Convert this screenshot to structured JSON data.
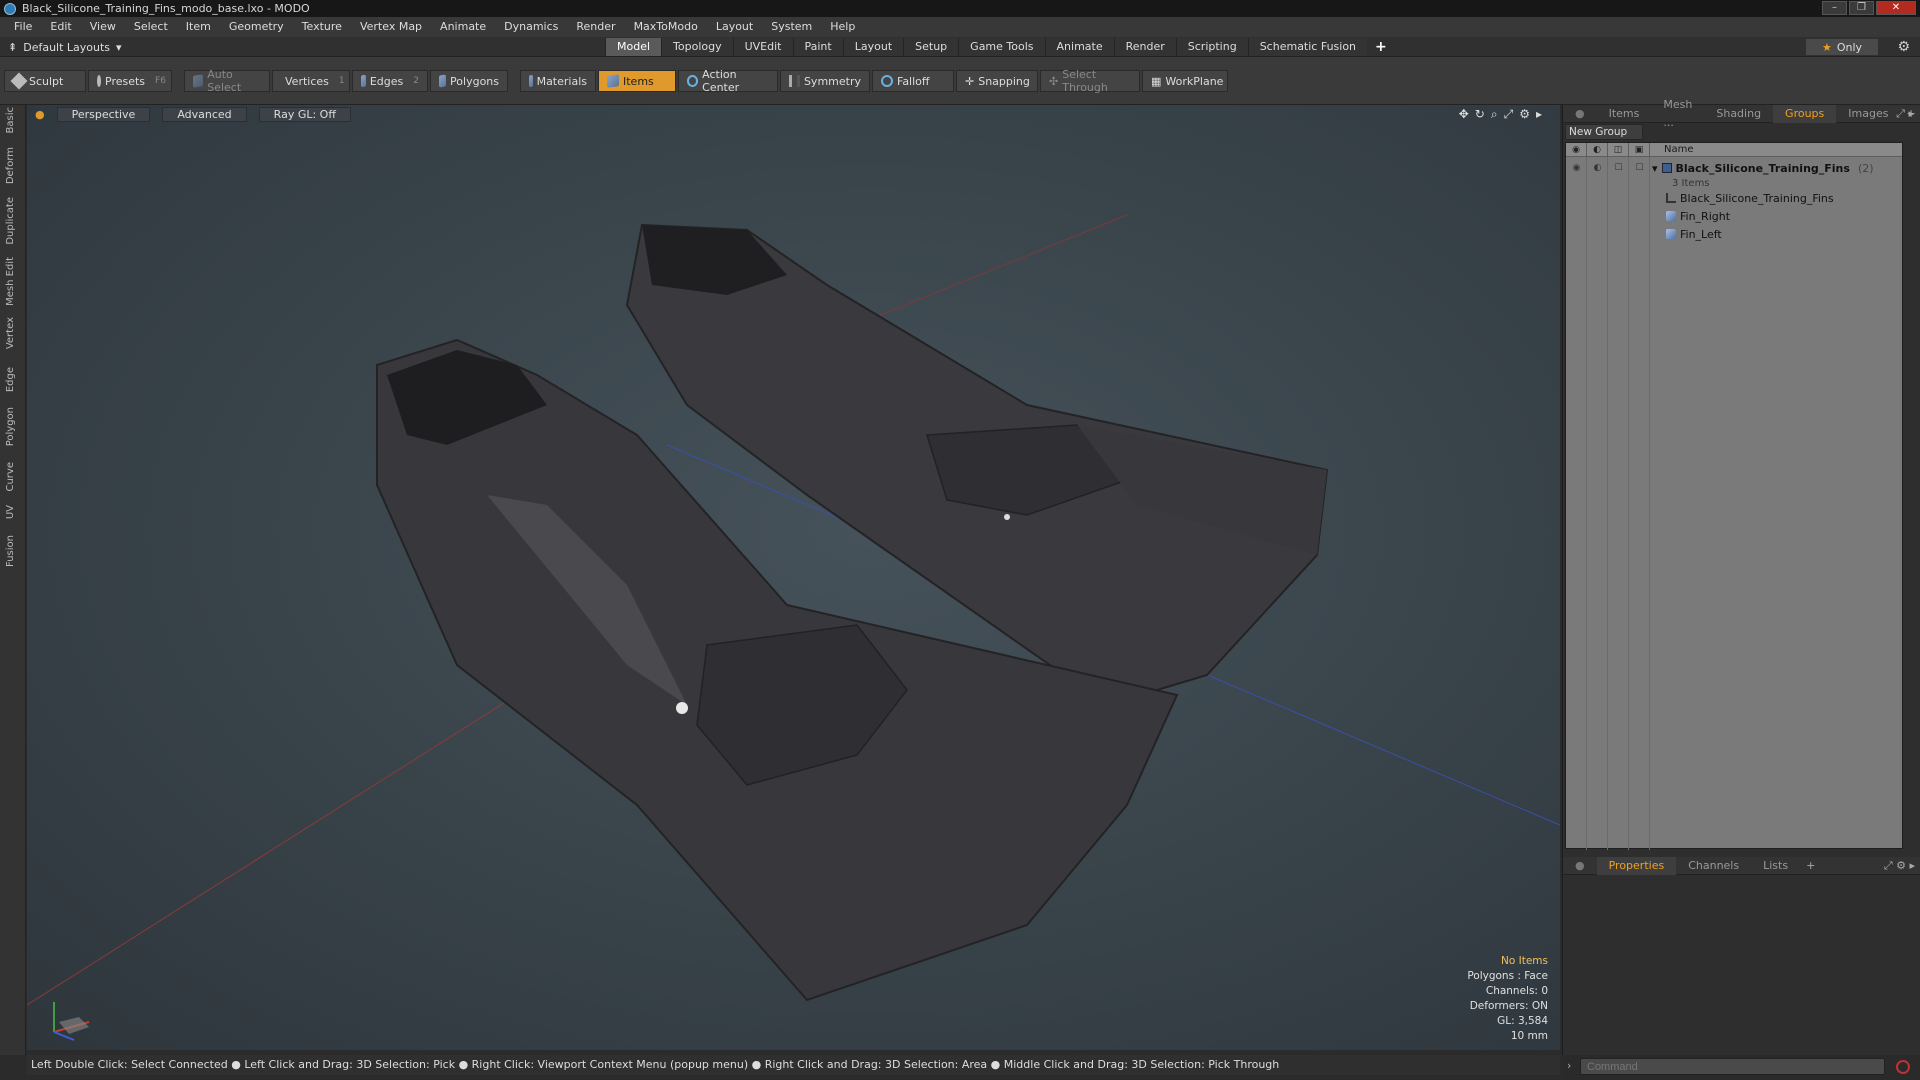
{
  "window": {
    "title": "Black_Silicone_Training_Fins_modo_base.lxo - MODO",
    "controls": [
      "–",
      "❐",
      "✕"
    ]
  },
  "menubar": [
    "File",
    "Edit",
    "View",
    "Select",
    "Item",
    "Geometry",
    "Texture",
    "Vertex Map",
    "Animate",
    "Dynamics",
    "Render",
    "MaxToModo",
    "Layout",
    "System",
    "Help"
  ],
  "layoutbar": {
    "layout_selector": "Default Layouts",
    "tabs": [
      "Model",
      "Topology",
      "UVEdit",
      "Paint",
      "Layout",
      "Setup",
      "Game Tools",
      "Animate",
      "Render",
      "Scripting",
      "Schematic Fusion"
    ],
    "active_tab": "Model",
    "add": "+",
    "only_label": "Only"
  },
  "toolbar": {
    "sculpt": "Sculpt",
    "presets": "Presets",
    "presets_key": "F6",
    "auto_select": "Auto Select",
    "vertices": "Vertices",
    "vertices_count": "1",
    "edges": "Edges",
    "edges_count": "2",
    "polygons": "Polygons",
    "materials": "Materials",
    "items": "Items",
    "action_center": "Action Center",
    "symmetry": "Symmetry",
    "falloff": "Falloff",
    "snapping": "Snapping",
    "select_through": "Select Through",
    "workplane": "WorkPlane"
  },
  "left_tabs": [
    "Basic",
    "Deform",
    "Duplicate",
    "Mesh Edit",
    "Vertex",
    "Edge",
    "Polygon",
    "Curve",
    "UV",
    "Fusion"
  ],
  "viewport": {
    "view_mode": "Perspective",
    "shading": "Advanced",
    "raygl": "Ray GL: Off",
    "stats": {
      "selection": "No Items",
      "polygons": "Polygons : Face",
      "channels": "Channels: 0",
      "deformers": "Deformers: ON",
      "gl": "GL: 3,584",
      "scale": "10 mm"
    }
  },
  "statusbar": "Left Double Click: Select Connected ● Left Click and Drag: 3D Selection: Pick ● Right Click: Viewport Context Menu (popup menu) ● Right Click and Drag: 3D Selection: Area ● Middle Click and Drag: 3D Selection: Pick Through",
  "right_panel": {
    "tabs": [
      "Items",
      "Mesh ...",
      "Shading",
      "Groups",
      "Images"
    ],
    "active_tab": "Groups",
    "new_group": "New Group",
    "column_name": "Name",
    "tree": {
      "group_name": "Black_Silicone_Training_Fins",
      "group_count": "(2)",
      "group_sub": "3 Items",
      "children": [
        "Black_Silicone_Training_Fins",
        "Fin_Right",
        "Fin_Left"
      ]
    },
    "bottom_tabs": [
      "Properties",
      "Channels",
      "Lists"
    ],
    "bottom_active": "Properties"
  },
  "command": {
    "placeholder": "Command"
  },
  "colors": {
    "accent": "#e09a2b",
    "viewport_bg": "#3a454c",
    "fin": "#3a3a3e"
  }
}
